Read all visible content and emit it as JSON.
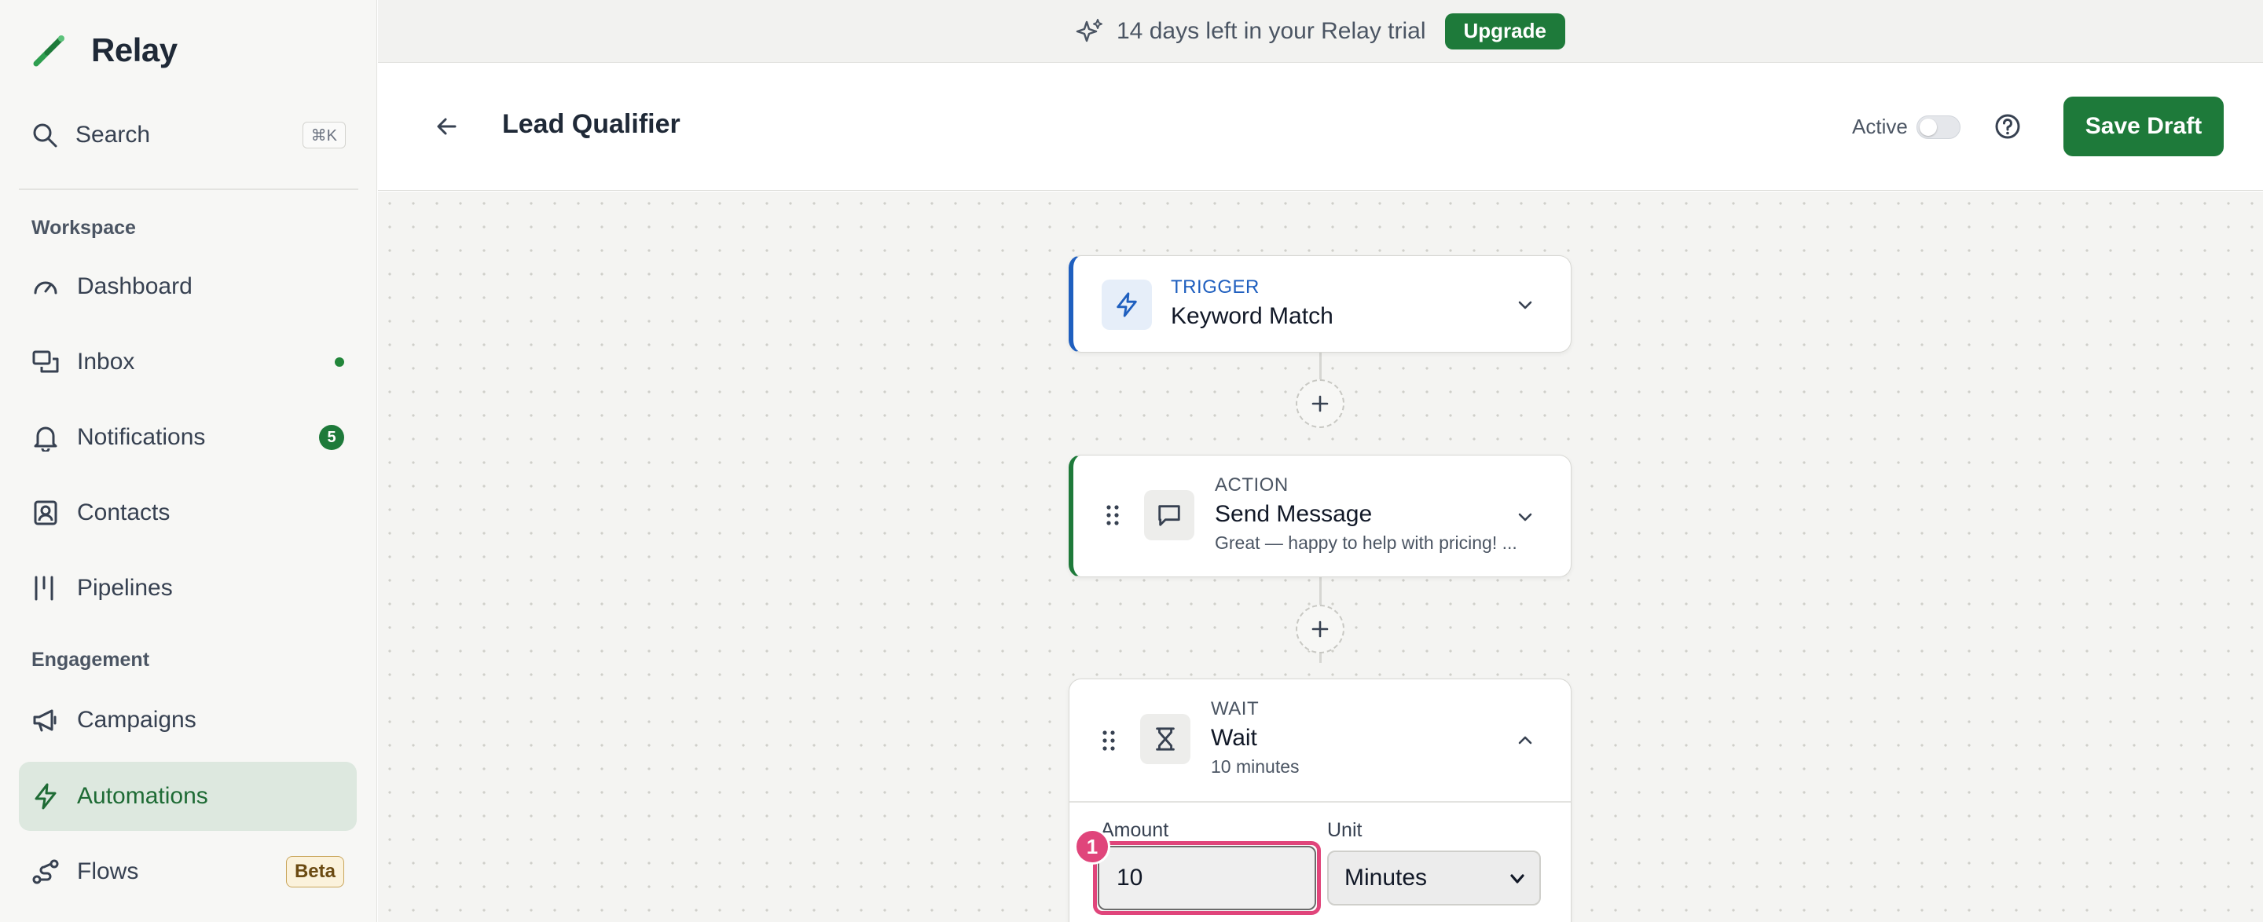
{
  "app": {
    "name": "Relay"
  },
  "sidebar": {
    "search": {
      "label": "Search",
      "shortcut": "⌘K"
    },
    "sections": [
      {
        "label": "Workspace"
      },
      {
        "label": "Engagement"
      }
    ],
    "items": [
      {
        "label": "Dashboard",
        "icon": "dashboard-icon"
      },
      {
        "label": "Inbox",
        "icon": "inbox-icon",
        "indicator": "dot"
      },
      {
        "label": "Notifications",
        "icon": "bell-icon",
        "count": "5"
      },
      {
        "label": "Contacts",
        "icon": "contacts-icon"
      },
      {
        "label": "Pipelines",
        "icon": "pipelines-icon"
      },
      {
        "label": "Campaigns",
        "icon": "megaphone-icon"
      },
      {
        "label": "Automations",
        "icon": "lightning-icon",
        "active": true
      },
      {
        "label": "Flows",
        "icon": "flows-icon",
        "badge": "Beta"
      }
    ]
  },
  "banner": {
    "text": "14 days left in your Relay trial",
    "button": "Upgrade"
  },
  "header": {
    "title": "Lead Qualifier",
    "active_label": "Active",
    "active_on": false,
    "save_label": "Save Draft"
  },
  "nodes": [
    {
      "kind": "TRIGGER",
      "title": "Keyword Match",
      "color": "#1f5fbf"
    },
    {
      "kind": "ACTION",
      "title": "Send Message",
      "subtitle": "Great — happy to help with pricing! ...",
      "color": "#1e7a3a"
    },
    {
      "kind": "WAIT",
      "title": "Wait",
      "subtitle": "10 minutes",
      "fields": {
        "amount_label": "Amount",
        "amount_value": "10",
        "unit_label": "Unit",
        "unit_value": "Minutes"
      }
    }
  ],
  "highlight": {
    "number": "1",
    "color": "#e0457b"
  },
  "colors": {
    "accent": "#1e7a3a",
    "trigger": "#1f5fbf"
  }
}
